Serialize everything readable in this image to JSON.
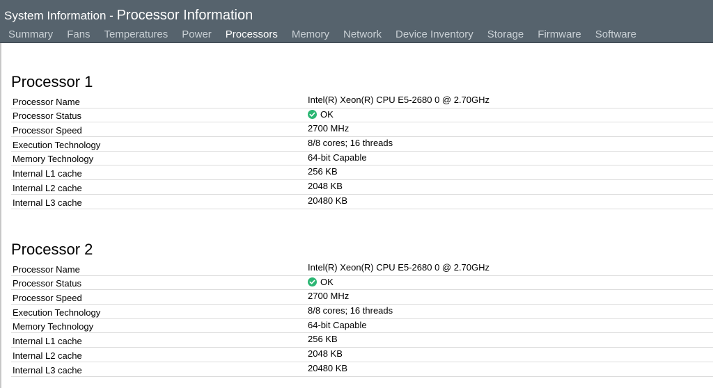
{
  "header": {
    "title_part1": "System Information - ",
    "title_part2": "Processor Information"
  },
  "tabs": [
    {
      "label": "Summary",
      "active": false
    },
    {
      "label": "Fans",
      "active": false
    },
    {
      "label": "Temperatures",
      "active": false
    },
    {
      "label": "Power",
      "active": false
    },
    {
      "label": "Processors",
      "active": true
    },
    {
      "label": "Memory",
      "active": false
    },
    {
      "label": "Network",
      "active": false
    },
    {
      "label": "Device Inventory",
      "active": false
    },
    {
      "label": "Storage",
      "active": false
    },
    {
      "label": "Firmware",
      "active": false
    },
    {
      "label": "Software",
      "active": false
    }
  ],
  "status_ok_color": "#2bb673",
  "processors": [
    {
      "title": "Processor 1",
      "rows": [
        {
          "label": "Processor Name",
          "value": "Intel(R) Xeon(R) CPU E5-2680 0 @ 2.70GHz"
        },
        {
          "label": "Processor Status",
          "value": "OK",
          "icon": "status-ok-icon"
        },
        {
          "label": "Processor Speed",
          "value": "2700 MHz"
        },
        {
          "label": "Execution Technology",
          "value": "8/8 cores; 16 threads"
        },
        {
          "label": "Memory Technology",
          "value": "64-bit Capable"
        },
        {
          "label": "Internal L1 cache",
          "value": "256 KB"
        },
        {
          "label": "Internal L2 cache",
          "value": "2048 KB"
        },
        {
          "label": "Internal L3 cache",
          "value": "20480 KB"
        }
      ]
    },
    {
      "title": "Processor 2",
      "rows": [
        {
          "label": "Processor Name",
          "value": "Intel(R) Xeon(R) CPU E5-2680 0 @ 2.70GHz"
        },
        {
          "label": "Processor Status",
          "value": "OK",
          "icon": "status-ok-icon"
        },
        {
          "label": "Processor Speed",
          "value": "2700 MHz"
        },
        {
          "label": "Execution Technology",
          "value": "8/8 cores; 16 threads"
        },
        {
          "label": "Memory Technology",
          "value": "64-bit Capable"
        },
        {
          "label": "Internal L1 cache",
          "value": "256 KB"
        },
        {
          "label": "Internal L2 cache",
          "value": "2048 KB"
        },
        {
          "label": "Internal L3 cache",
          "value": "20480 KB"
        }
      ]
    }
  ]
}
